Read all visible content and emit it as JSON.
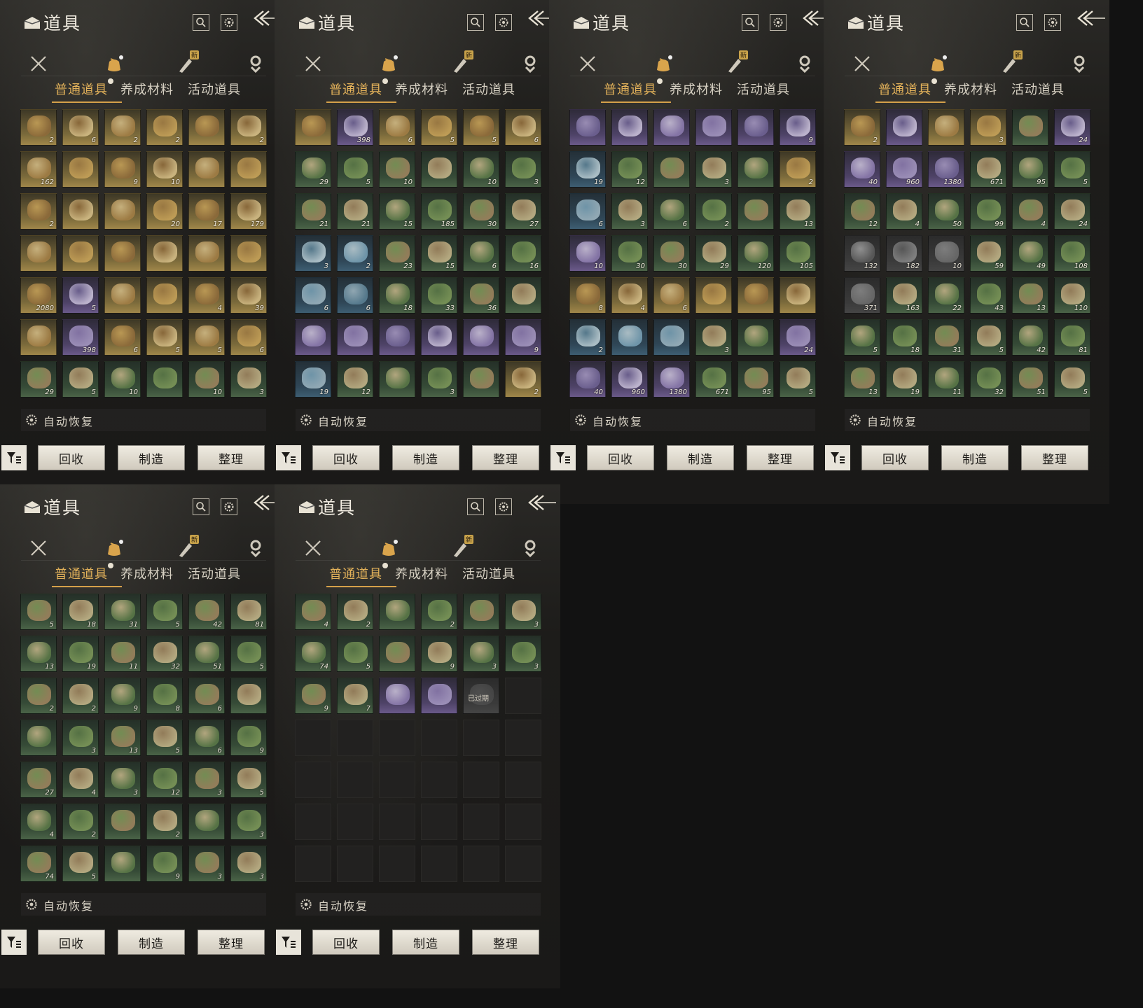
{
  "panels": [
    {
      "title": "道具",
      "category_badge": "新",
      "subtabs": [
        "普通道具",
        "养成材料",
        "活动道具"
      ],
      "auto_restore": "自动恢复",
      "buttons": [
        "回收",
        "制造",
        "整理"
      ],
      "items": [
        [
          "gold",
          "2"
        ],
        [
          "gold",
          "6"
        ],
        [
          "gold",
          "2"
        ],
        [
          "gold",
          "2"
        ],
        [
          "gold",
          ""
        ],
        [
          "gold",
          "2"
        ],
        [
          "gold",
          "162"
        ],
        [
          "gold",
          ""
        ],
        [
          "gold",
          "9"
        ],
        [
          "gold",
          "10"
        ],
        [
          "gold",
          ""
        ],
        [
          "gold",
          ""
        ],
        [
          "gold",
          "2"
        ],
        [
          "gold",
          ""
        ],
        [
          "gold",
          ""
        ],
        [
          "gold",
          "20"
        ],
        [
          "gold",
          "17"
        ],
        [
          "gold",
          "179"
        ],
        [
          "gold",
          ""
        ],
        [
          "gold",
          ""
        ],
        [
          "gold",
          ""
        ],
        [
          "gold",
          ""
        ],
        [
          "gold",
          ""
        ],
        [
          "gold",
          ""
        ],
        [
          "gold",
          "2080"
        ],
        [
          "purple",
          "5"
        ],
        [
          "gold",
          ""
        ],
        [
          "gold",
          ""
        ],
        [
          "gold",
          "4"
        ],
        [
          "gold",
          "39"
        ],
        [
          "gold",
          ""
        ],
        [
          "purple",
          "398"
        ],
        [
          "gold",
          "6"
        ],
        [
          "gold",
          "5"
        ],
        [
          "gold",
          "5"
        ],
        [
          "gold",
          "6"
        ],
        [
          "green",
          "29"
        ],
        [
          "green",
          "5"
        ],
        [
          "green",
          "10"
        ],
        [
          "green",
          ""
        ],
        [
          "green",
          "10"
        ],
        [
          "green",
          "3"
        ]
      ]
    },
    {
      "title": "道具",
      "category_badge": "新",
      "subtabs": [
        "普通道具",
        "养成材料",
        "活动道具"
      ],
      "auto_restore": "自动恢复",
      "buttons": [
        "回收",
        "制造",
        "整理"
      ],
      "items": [
        [
          "gold",
          ""
        ],
        [
          "purple",
          "398"
        ],
        [
          "gold",
          "6"
        ],
        [
          "gold",
          "5"
        ],
        [
          "gold",
          "5"
        ],
        [
          "gold",
          "6"
        ],
        [
          "green",
          "29"
        ],
        [
          "green",
          "5"
        ],
        [
          "green",
          "10"
        ],
        [
          "green",
          ""
        ],
        [
          "green",
          "10"
        ],
        [
          "green",
          "3"
        ],
        [
          "green",
          "21"
        ],
        [
          "green",
          "21"
        ],
        [
          "green",
          "15"
        ],
        [
          "green",
          "185"
        ],
        [
          "green",
          "30"
        ],
        [
          "green",
          "27"
        ],
        [
          "blue",
          "3"
        ],
        [
          "blue",
          "2"
        ],
        [
          "green",
          "23"
        ],
        [
          "green",
          "15"
        ],
        [
          "green",
          "6"
        ],
        [
          "green",
          "16"
        ],
        [
          "blue",
          "6"
        ],
        [
          "blue",
          "6"
        ],
        [
          "green",
          "18"
        ],
        [
          "green",
          "33"
        ],
        [
          "green",
          "36"
        ],
        [
          "green",
          ""
        ],
        [
          "purple",
          ""
        ],
        [
          "purple",
          ""
        ],
        [
          "purple",
          ""
        ],
        [
          "purple",
          ""
        ],
        [
          "purple",
          ""
        ],
        [
          "purple",
          "9"
        ],
        [
          "blue",
          "19"
        ],
        [
          "green",
          "12"
        ],
        [
          "green",
          ""
        ],
        [
          "green",
          "3"
        ],
        [
          "green",
          ""
        ],
        [
          "gold",
          "2"
        ]
      ]
    },
    {
      "title": "道具",
      "category_badge": "新",
      "subtabs": [
        "普通道具",
        "养成材料",
        "活动道具"
      ],
      "auto_restore": "自动恢复",
      "buttons": [
        "回收",
        "制造",
        "整理"
      ],
      "items": [
        [
          "purple",
          ""
        ],
        [
          "purple",
          ""
        ],
        [
          "purple",
          ""
        ],
        [
          "purple",
          ""
        ],
        [
          "purple",
          ""
        ],
        [
          "purple",
          "9"
        ],
        [
          "blue",
          "19"
        ],
        [
          "green",
          "12"
        ],
        [
          "green",
          ""
        ],
        [
          "green",
          "3"
        ],
        [
          "green",
          ""
        ],
        [
          "gold",
          "2"
        ],
        [
          "blue",
          "6"
        ],
        [
          "green",
          "3"
        ],
        [
          "green",
          "6"
        ],
        [
          "green",
          "2"
        ],
        [
          "green",
          ""
        ],
        [
          "green",
          "13"
        ],
        [
          "purple",
          "10"
        ],
        [
          "green",
          "30"
        ],
        [
          "green",
          "30"
        ],
        [
          "green",
          "29"
        ],
        [
          "green",
          "120"
        ],
        [
          "green",
          "105"
        ],
        [
          "gold",
          "8"
        ],
        [
          "gold",
          "4"
        ],
        [
          "gold",
          "6"
        ],
        [
          "gold",
          ""
        ],
        [
          "gold",
          ""
        ],
        [
          "gold",
          ""
        ],
        [
          "blue",
          "2"
        ],
        [
          "blue",
          ""
        ],
        [
          "blue",
          ""
        ],
        [
          "green",
          "3"
        ],
        [
          "green",
          ""
        ],
        [
          "purple",
          "24"
        ],
        [
          "purple",
          "40"
        ],
        [
          "purple",
          "960"
        ],
        [
          "purple",
          "1380"
        ],
        [
          "green",
          "671"
        ],
        [
          "green",
          "95"
        ],
        [
          "green",
          "5"
        ]
      ]
    },
    {
      "title": "道具",
      "category_badge": "新",
      "subtabs": [
        "普通道具",
        "养成材料",
        "活动道具"
      ],
      "auto_restore": "自动恢复",
      "buttons": [
        "回收",
        "制造",
        "整理"
      ],
      "items": [
        [
          "gold",
          "2"
        ],
        [
          "purple",
          ""
        ],
        [
          "gold",
          ""
        ],
        [
          "gold",
          "3"
        ],
        [
          "green",
          ""
        ],
        [
          "purple",
          "24"
        ],
        [
          "purple",
          "40"
        ],
        [
          "purple",
          "960"
        ],
        [
          "purple",
          "1380"
        ],
        [
          "green",
          "671"
        ],
        [
          "green",
          "95"
        ],
        [
          "green",
          "5"
        ],
        [
          "green",
          "12"
        ],
        [
          "green",
          "4"
        ],
        [
          "green",
          "50"
        ],
        [
          "green",
          "99"
        ],
        [
          "green",
          "4"
        ],
        [
          "green",
          "24"
        ],
        [
          "gray",
          "132"
        ],
        [
          "gray",
          "182"
        ],
        [
          "gray",
          "10"
        ],
        [
          "green",
          "59"
        ],
        [
          "green",
          "49"
        ],
        [
          "green",
          "108"
        ],
        [
          "gray",
          "371"
        ],
        [
          "green",
          "163"
        ],
        [
          "green",
          "22"
        ],
        [
          "green",
          "43"
        ],
        [
          "green",
          "13"
        ],
        [
          "green",
          "110"
        ],
        [
          "green",
          "5"
        ],
        [
          "green",
          "18"
        ],
        [
          "green",
          "31"
        ],
        [
          "green",
          "5"
        ],
        [
          "green",
          "42"
        ],
        [
          "green",
          "81"
        ],
        [
          "green",
          "13"
        ],
        [
          "green",
          "19"
        ],
        [
          "green",
          "11"
        ],
        [
          "green",
          "32"
        ],
        [
          "green",
          "51"
        ],
        [
          "green",
          "5"
        ]
      ]
    },
    {
      "title": "道具",
      "category_badge": "新",
      "subtabs": [
        "普通道具",
        "养成材料",
        "活动道具"
      ],
      "auto_restore": "自动恢复",
      "buttons": [
        "回收",
        "制造",
        "整理"
      ],
      "items": [
        [
          "green",
          "5"
        ],
        [
          "green",
          "18"
        ],
        [
          "green",
          "31"
        ],
        [
          "green",
          "5"
        ],
        [
          "green",
          "42"
        ],
        [
          "green",
          "81"
        ],
        [
          "green",
          "13"
        ],
        [
          "green",
          "19"
        ],
        [
          "green",
          "11"
        ],
        [
          "green",
          "32"
        ],
        [
          "green",
          "51"
        ],
        [
          "green",
          "5"
        ],
        [
          "green",
          "2"
        ],
        [
          "green",
          "2"
        ],
        [
          "green",
          "9"
        ],
        [
          "green",
          "8"
        ],
        [
          "green",
          "6"
        ],
        [
          "green",
          ""
        ],
        [
          "green",
          ""
        ],
        [
          "green",
          "3"
        ],
        [
          "green",
          "13"
        ],
        [
          "green",
          "5"
        ],
        [
          "green",
          "6"
        ],
        [
          "green",
          "9"
        ],
        [
          "green",
          "27"
        ],
        [
          "green",
          "4"
        ],
        [
          "green",
          "3"
        ],
        [
          "green",
          "12"
        ],
        [
          "green",
          "3"
        ],
        [
          "green",
          "5"
        ],
        [
          "green",
          "4"
        ],
        [
          "green",
          "2"
        ],
        [
          "green",
          ""
        ],
        [
          "green",
          "2"
        ],
        [
          "green",
          ""
        ],
        [
          "green",
          "3"
        ],
        [
          "green",
          "74"
        ],
        [
          "green",
          "5"
        ],
        [
          "green",
          ""
        ],
        [
          "green",
          "9"
        ],
        [
          "green",
          "3"
        ],
        [
          "green",
          "3"
        ]
      ]
    },
    {
      "title": "道具",
      "category_badge": "新",
      "subtabs": [
        "普通道具",
        "养成材料",
        "活动道具"
      ],
      "auto_restore": "自动恢复",
      "buttons": [
        "回收",
        "制造",
        "整理"
      ],
      "expired_label": "已过期",
      "items": [
        [
          "green",
          "4"
        ],
        [
          "green",
          "2"
        ],
        [
          "green",
          ""
        ],
        [
          "green",
          "2"
        ],
        [
          "green",
          ""
        ],
        [
          "green",
          "3"
        ],
        [
          "green",
          "74"
        ],
        [
          "green",
          "5"
        ],
        [
          "green",
          ""
        ],
        [
          "green",
          "9"
        ],
        [
          "green",
          "3"
        ],
        [
          "green",
          "3"
        ],
        [
          "green",
          "9"
        ],
        [
          "green",
          "7"
        ],
        [
          "purple",
          ""
        ],
        [
          "purple",
          ""
        ],
        [
          "gray",
          "expired"
        ],
        [
          "empty",
          ""
        ],
        [
          "empty",
          ""
        ],
        [
          "empty",
          ""
        ],
        [
          "empty",
          ""
        ],
        [
          "empty",
          ""
        ],
        [
          "empty",
          ""
        ],
        [
          "empty",
          ""
        ],
        [
          "empty",
          ""
        ],
        [
          "empty",
          ""
        ],
        [
          "empty",
          ""
        ],
        [
          "empty",
          ""
        ],
        [
          "empty",
          ""
        ],
        [
          "empty",
          ""
        ],
        [
          "empty",
          ""
        ],
        [
          "empty",
          ""
        ],
        [
          "empty",
          ""
        ],
        [
          "empty",
          ""
        ],
        [
          "empty",
          ""
        ],
        [
          "empty",
          ""
        ],
        [
          "empty",
          ""
        ],
        [
          "empty",
          ""
        ],
        [
          "empty",
          ""
        ],
        [
          "empty",
          ""
        ],
        [
          "empty",
          ""
        ],
        [
          "empty",
          ""
        ]
      ]
    }
  ],
  "colors": {
    "accent": "#e3b25a",
    "rarity_gold": "#a08749",
    "rarity_purple": "#6b5a8a",
    "rarity_green": "#4a6347",
    "rarity_blue": "#3d5e72",
    "rarity_gray": "#454545"
  }
}
